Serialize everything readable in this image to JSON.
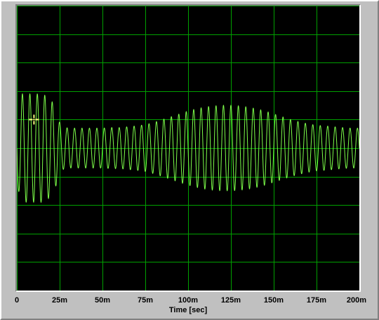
{
  "chart_data": {
    "type": "line",
    "title": "",
    "xlabel": "Time [sec]",
    "ylabel": "",
    "xlim": [
      0,
      0.2
    ],
    "ylim": [
      -5,
      5
    ],
    "x_tick_labels": [
      "0",
      "25m",
      "50m",
      "75m",
      "100m",
      "125m",
      "150m",
      "175m",
      "200m"
    ],
    "grid": true,
    "background": "#000000",
    "grid_color": "#00a000",
    "line_color": "#7dff4a",
    "cursor_color": "#ffff80",
    "cursor": {
      "x": 0.01,
      "y": 1.0
    },
    "series": [
      {
        "x": [
          0,
          0.003,
          0.006,
          0.009,
          0.012,
          0.015,
          0.018,
          0.021,
          0.023,
          0.025,
          0.027,
          0.03,
          0.035,
          0.04,
          0.045,
          0.05,
          0.055,
          0.06,
          0.065,
          0.07,
          0.075,
          0.08,
          0.085,
          0.09,
          0.095,
          0.1,
          0.105,
          0.11,
          0.115,
          0.12,
          0.125,
          0.13,
          0.135,
          0.14,
          0.145,
          0.15,
          0.155,
          0.16,
          0.165,
          0.17,
          0.175,
          0.18,
          0.185,
          0.19,
          0.195,
          0.2
        ],
        "envelope": [
          1.3,
          1.9,
          1.9,
          1.9,
          1.9,
          1.9,
          1.8,
          1.6,
          1.3,
          0.9,
          0.75,
          0.7,
          0.7,
          0.7,
          0.7,
          0.7,
          0.72,
          0.72,
          0.75,
          0.78,
          0.82,
          0.9,
          1.0,
          1.1,
          1.2,
          1.3,
          1.38,
          1.44,
          1.48,
          1.5,
          1.5,
          1.48,
          1.44,
          1.38,
          1.3,
          1.2,
          1.1,
          1.0,
          0.92,
          0.85,
          0.8,
          0.78,
          0.75,
          0.72,
          0.7,
          0.7
        ],
        "frequency_hz": 230,
        "offset": 0
      }
    ]
  }
}
